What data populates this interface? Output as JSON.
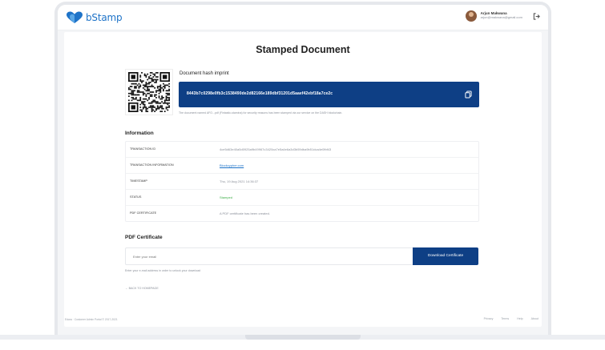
{
  "app": {
    "logo_text": "bStamp",
    "brand_color": "#1e73c8",
    "accent_color": "#0e3f85"
  },
  "user": {
    "name": "Arjun Makwana",
    "email": "arjun@makwana@gmail.com"
  },
  "page": {
    "title": "Stamped Document"
  },
  "hash": {
    "label": "Document hash imprint",
    "value": "8443b7c0298e0fb3c1538490de2d82166e189dbf31201d5aaef42ebf18a7ce2c",
    "note": "The document named AFO...pdf (Fintastic-stamina) for security reasons has been stamped via our service on the DASH blockchain."
  },
  "information": {
    "title": "Information",
    "rows": [
      {
        "key": "TRANSACTION ID",
        "value": "4ce5d63e40a5d0925a9b49967c3420ca7e5a4e6a3d3b59dba9b51dca4e0fbf43"
      },
      {
        "key": "TRANSACTION INFORMATION",
        "value": "Blockcypher.com"
      },
      {
        "key": "TIMESTAMP",
        "value": "Thu, 19 Aug 2021 14:36:37"
      },
      {
        "key": "STATUS",
        "value": "Stamped"
      },
      {
        "key": "PDF CERTIFICATE",
        "value": "A PDF certificate has been created."
      }
    ]
  },
  "certificate": {
    "title": "PDF Certificate",
    "email_placeholder": "Enter your email",
    "download_label": "Download Certificate",
    "hint": "Enter your e-mail address in order to unlock your download",
    "back_label": "← BACK TO HOMEPAGE"
  },
  "footer": {
    "copyright": "Edara · Customer Admin Portal © 2017-2021",
    "links": [
      "Privacy",
      "Terms",
      "Help",
      "About"
    ]
  },
  "icons": {
    "logo": "heart-logo-icon",
    "logout": "logout-icon",
    "copy": "copy-icon",
    "qr": "qr-code"
  }
}
